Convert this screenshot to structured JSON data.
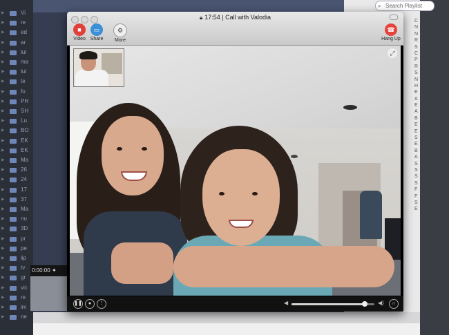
{
  "window": {
    "title": "17:54 | Call with Valodia"
  },
  "toolbar": {
    "video_label": "Video",
    "share_label": "Share",
    "more_label": "More",
    "hangup_label": "Hang Up"
  },
  "background": {
    "search_placeholder": "Search Playlist",
    "list_items": [
      "Vi",
      "re",
      "ed",
      "ar",
      "lul",
      "ma",
      "lul",
      "te",
      "fo",
      "PH",
      "SH",
      "Lu",
      "BO",
      "EK",
      "EK",
      "Ma",
      "26",
      "24",
      "17",
      "37",
      "Ma",
      "nu",
      "3D",
      "pr",
      "pe",
      "lip",
      "tv",
      "gr",
      "vic",
      "re",
      "im",
      "ne"
    ],
    "right_letters": [
      "C",
      "N",
      "N",
      "R",
      "S",
      "C",
      "P",
      "R",
      "S",
      "N",
      "H",
      "E",
      "A",
      "E",
      "A",
      "B",
      "E",
      "E",
      "S",
      "E",
      "B",
      "A",
      "S",
      "S",
      "S",
      "S",
      "F",
      "F",
      "S",
      "E"
    ],
    "time": "0:00:00"
  },
  "controls": {
    "volume": 0.88
  },
  "colors": {
    "video_button": "#e0403a",
    "share_button": "#3b8fd6",
    "hangup_button": "#e5443c",
    "more_button": "#5d5d5d"
  }
}
